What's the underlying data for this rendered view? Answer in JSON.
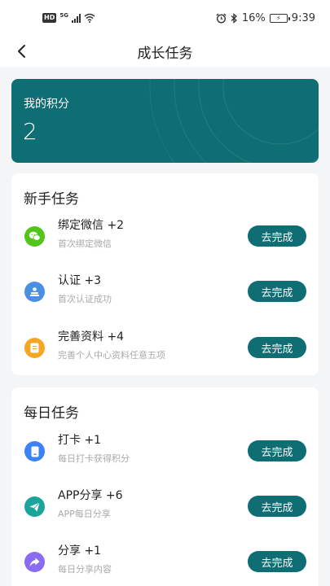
{
  "status_bar": {
    "hd": "HD",
    "network": "5G",
    "battery_percent": "16%",
    "time": "9:39"
  },
  "header": {
    "title": "成长任务"
  },
  "points": {
    "label": "我的积分",
    "value": "2"
  },
  "sections": [
    {
      "title": "新手任务",
      "tasks": [
        {
          "title": "绑定微信 +2",
          "desc": "首次绑定微信",
          "button": "去完成",
          "icon": "wechat-icon",
          "color": "#52c41a"
        },
        {
          "title": "认证 +3",
          "desc": "首次认证成功",
          "button": "去完成",
          "icon": "verify-icon",
          "color": "#4a90e2"
        },
        {
          "title": "完善资料 +4",
          "desc": "完善个人中心资料任意五项",
          "button": "去完成",
          "icon": "document-icon",
          "color": "#f5a623"
        }
      ]
    },
    {
      "title": "每日任务",
      "tasks": [
        {
          "title": "打卡 +1",
          "desc": "每日打卡获得积分",
          "button": "去完成",
          "icon": "phone-icon",
          "color": "#3b82f6"
        },
        {
          "title": "APP分享 +6",
          "desc": "APP每日分享",
          "button": "去完成",
          "icon": "send-icon",
          "color": "#1ba39c"
        },
        {
          "title": "分享 +1",
          "desc": "每日分享内容",
          "button": "去完成",
          "icon": "share-icon",
          "color": "#8b6cf0"
        }
      ]
    }
  ],
  "colors": {
    "accent": "#0f6e73",
    "background": "#f4f5f7"
  }
}
